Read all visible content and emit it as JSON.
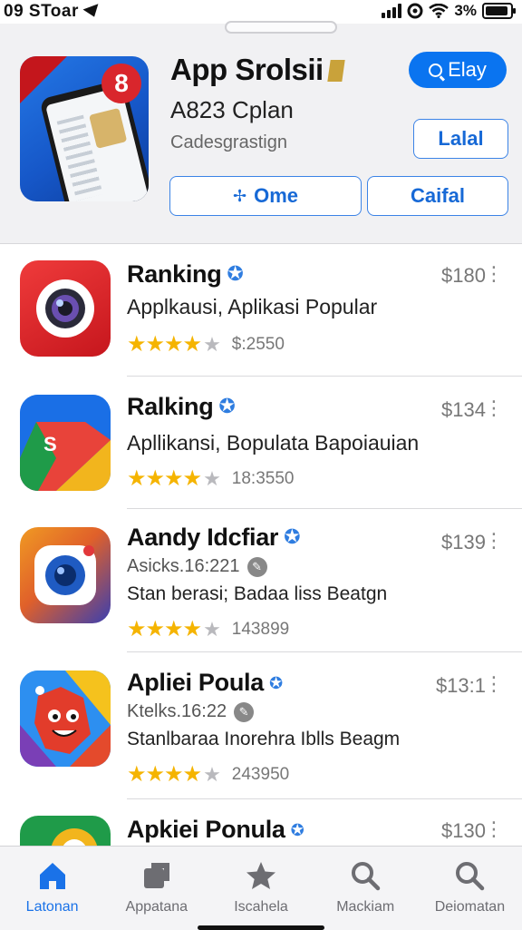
{
  "status": {
    "time": "09 SToar",
    "battery": "3%"
  },
  "header": {
    "title": "App Srolsii",
    "subtitle": "A823 Cplan",
    "category": "Cadesgrastign",
    "primary_button": "Elay",
    "button_right_top": "Lalal",
    "button_left_bottom": "Ome",
    "button_right_bottom": "Caifal"
  },
  "apps": [
    {
      "name": "Ranking",
      "desc": "Applkausi, Aplikasi Popular",
      "price": "$180",
      "rating_count": "$:2550"
    },
    {
      "name": "Ralking",
      "desc": "Apllikansi, Bopulata Bapoiauian",
      "price": "$134",
      "rating_count": "18:3550"
    },
    {
      "name": "Aandy Idcfiar",
      "meta": "Asicks.16:221",
      "desc": "Stan berasi; Badaa liss Beatgn",
      "price": "$139",
      "rating_count": "143899"
    },
    {
      "name": "Apliei Poula",
      "meta": "Ktelks.16:22",
      "desc": "Stanlbaraa Inorehra Iblls Beagm",
      "price": "$13:1",
      "rating_count": "243950"
    },
    {
      "name": "Apkiei Ponula",
      "price": "$130"
    }
  ],
  "tabs": [
    {
      "label": "Latonan",
      "icon": "home-icon",
      "active": true
    },
    {
      "label": "Appatana",
      "icon": "apps-icon",
      "active": false
    },
    {
      "label": "Iscahela",
      "icon": "star-icon",
      "active": false
    },
    {
      "label": "Mackiam",
      "icon": "search-icon",
      "active": false
    },
    {
      "label": "Deiomatan",
      "icon": "search-icon",
      "active": false
    }
  ],
  "colors": {
    "accent": "#0a74f0",
    "star": "#f5b400",
    "background": "#ffffff"
  }
}
